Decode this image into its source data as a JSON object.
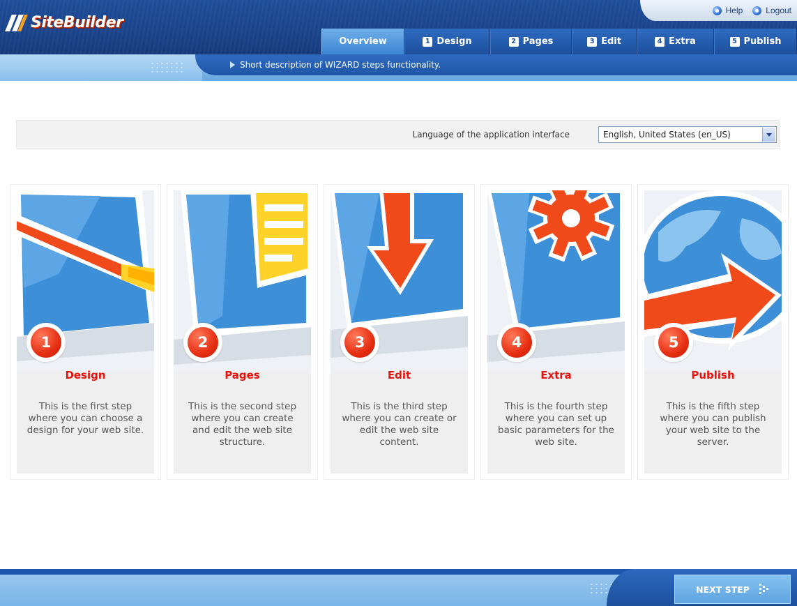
{
  "app": {
    "logo_text": "SiteBuilder"
  },
  "util": {
    "help": "Help",
    "logout": "Logout"
  },
  "tabs": [
    {
      "label": "Overview",
      "num": ""
    },
    {
      "label": "Design",
      "num": "1"
    },
    {
      "label": "Pages",
      "num": "2"
    },
    {
      "label": "Edit",
      "num": "3"
    },
    {
      "label": "Extra",
      "num": "4"
    },
    {
      "label": "Publish",
      "num": "5"
    }
  ],
  "infobar": {
    "text": "Short description of WIZARD steps functionality."
  },
  "language": {
    "label": "Language of the application interface",
    "selected": "English, United States (en_US)"
  },
  "steps": [
    {
      "num": "1",
      "title": "Design",
      "desc": "This is the first step where you can choose a design for your web site."
    },
    {
      "num": "2",
      "title": "Pages",
      "desc": "This is the second step where you can create and edit the web site structure."
    },
    {
      "num": "3",
      "title": "Edit",
      "desc": "This is the third step where you can create or edit the web site content."
    },
    {
      "num": "4",
      "title": "Extra",
      "desc": "This is the fourth step where you can set up basic parameters for the web site."
    },
    {
      "num": "5",
      "title": "Publish",
      "desc": "This is the fifth step where you can publish your web site to the server."
    }
  ],
  "footer": {
    "next_label": "NEXT STEP"
  },
  "colors": {
    "header_blue": "#1d4f9c",
    "active_tab": "#3e86d3",
    "accent_red": "#e8120c",
    "card_bg": "#efefef"
  }
}
